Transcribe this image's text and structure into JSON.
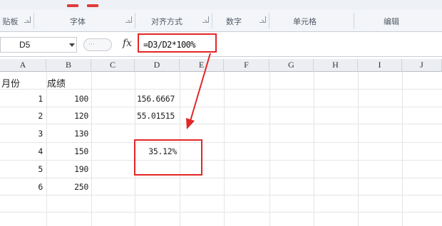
{
  "colors": {
    "accent_red": "#e32626",
    "header_bg": "#eceef2",
    "gridline": "#e3e5e8"
  },
  "ribbon": {
    "groups": [
      {
        "label": "贴板"
      },
      {
        "label": "字体"
      },
      {
        "label": "对齐方式"
      },
      {
        "label": "数字"
      },
      {
        "label": "单元格"
      },
      {
        "label": "编辑"
      }
    ]
  },
  "formula_bar": {
    "name_box": "D5",
    "fx_icon": "fx-icon",
    "formula": "=D3/D2*100%"
  },
  "columns": [
    "A",
    "B",
    "C",
    "D",
    "E",
    "F",
    "G",
    "H",
    "I",
    "J"
  ],
  "cells": {
    "A1": "月份",
    "B1": "成绩",
    "A2": "1",
    "B2": "100",
    "D2": "156.6667",
    "A3": "2",
    "B3": "120",
    "D3": "55.01515",
    "A4": "3",
    "B4": "130",
    "A5": "4",
    "B5": "150",
    "D5": "35.12%",
    "A6": "5",
    "B6": "190",
    "A7": "6",
    "B7": "250"
  }
}
